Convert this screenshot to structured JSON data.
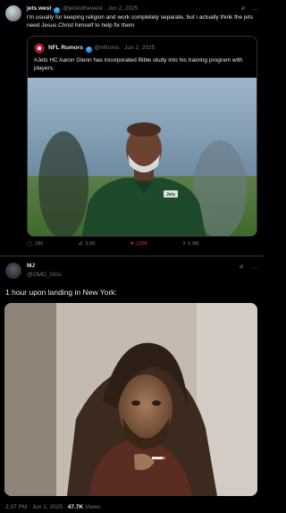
{
  "quoted_by_tweet": {
    "author_name": "jets west",
    "author_handle": "@jetstothewest",
    "date": "Jun 2, 2025",
    "text": "i'm usually for keeping religion and work completely separate, but i actually think the jets need Jesus Christ himself to help fix them",
    "quote": {
      "author_name": "NFL Rumors",
      "author_handle": "@nflrums",
      "date": "Jun 2, 2025",
      "text": "#Jets HC Aaron Glenn has incorporated Bible study into his training program with players.",
      "photo_shirt_text": "Jets"
    },
    "metrics": {
      "replies": "289",
      "reposts": "5.5K",
      "likes": "120K",
      "views": "6.9M"
    }
  },
  "main_tweet": {
    "author_name": "MJ",
    "author_handle": "@OMD_OGs",
    "text": "1 hour upon landing in New York:",
    "time": "2:37 PM",
    "date": "Jun 2, 2025",
    "views_count": "47.7K",
    "views_label": "Views"
  },
  "icons": {
    "separator": "·",
    "more": "…",
    "grok": "⌀",
    "reply": "◯",
    "repost": "⇄",
    "like": "♥",
    "views": "‖",
    "verified": "✓"
  },
  "colors": {
    "background": "#000000",
    "text": "#e7e9ea",
    "secondary": "#71767b",
    "border": "#2f3336",
    "verified": "#1d9bf0",
    "like": "#f91880",
    "jets_green": "#1e4a2c"
  }
}
